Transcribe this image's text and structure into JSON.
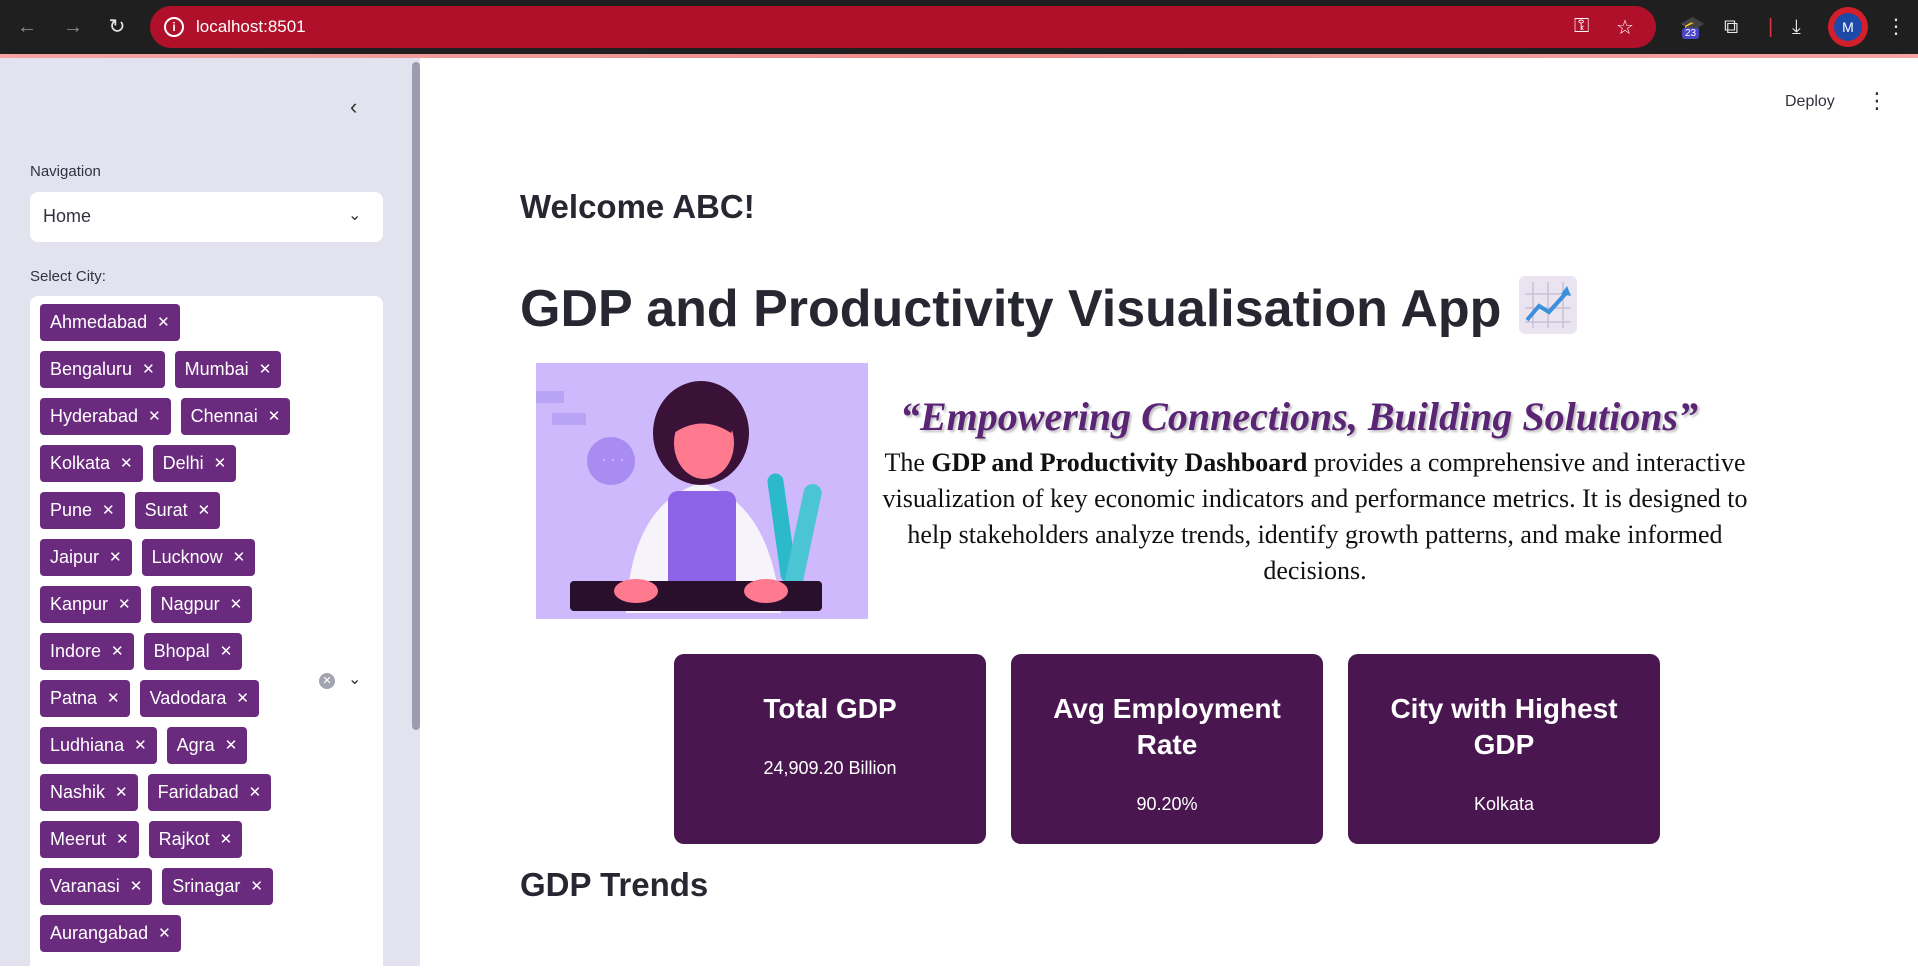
{
  "browser": {
    "url": "localhost:8501",
    "extension_badge": "23",
    "profile_initial": "M"
  },
  "sidebar": {
    "navigation_label": "Navigation",
    "navigation_value": "Home",
    "city_label": "Select City:",
    "cities": [
      "Ahmedabad",
      "Bengaluru",
      "Mumbai",
      "Hyderabad",
      "Chennai",
      "Kolkata",
      "Delhi",
      "Pune",
      "Surat",
      "Jaipur",
      "Lucknow",
      "Kanpur",
      "Nagpur",
      "Indore",
      "Bhopal",
      "Patna",
      "Vadodara",
      "Ludhiana",
      "Agra",
      "Nashik",
      "Faridabad",
      "Meerut",
      "Rajkot",
      "Varanasi",
      "Srinagar",
      "Aurangabad"
    ],
    "tag_color": "#6a2a7e"
  },
  "header": {
    "deploy_label": "Deploy"
  },
  "main": {
    "welcome": "Welcome ABC!",
    "title": "GDP and Productivity Visualisation App",
    "quote": "“Empowering Connections, Building Solutions”",
    "description_prefix": "The ",
    "description_bold": "GDP and Productivity Dashboard",
    "description_rest": " provides a comprehensive and interactive visualization of key economic indicators and performance metrics. It is designed to help stakeholders analyze trends, identify growth patterns, and make informed decisions.",
    "cards": [
      {
        "title": "Total GDP",
        "value": "24,909.20 Billion"
      },
      {
        "title": "Avg Employment Rate",
        "value": "90.20%"
      },
      {
        "title": "City with Highest GDP",
        "value": "Kolkata"
      }
    ],
    "section_title": "GDP Trends",
    "card_color": "#4a1650"
  }
}
